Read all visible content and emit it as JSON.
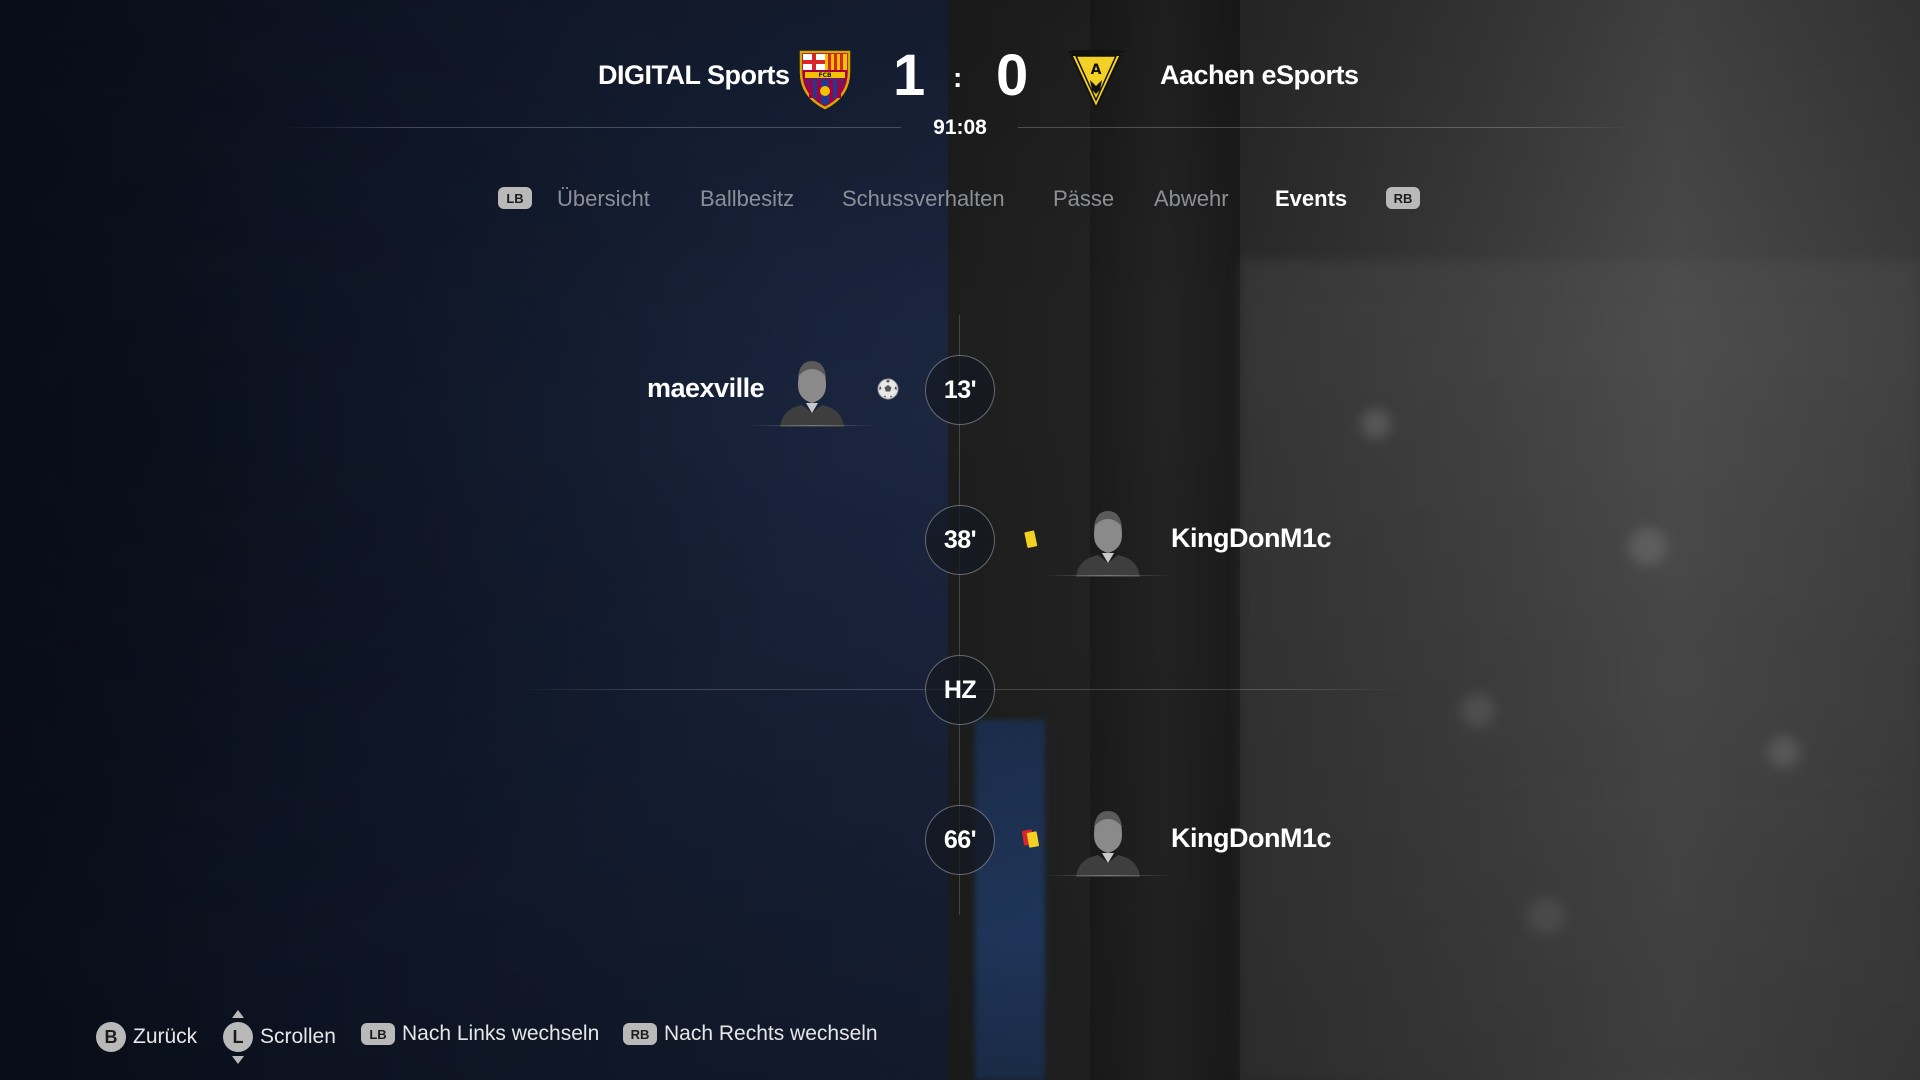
{
  "match": {
    "home_team": "DIGITAL Sports",
    "away_team": "Aachen eSports",
    "home_score": "1",
    "away_score": "0",
    "separator": ":",
    "clock": "91:08",
    "home_crest_icon": "fc-barcelona-crest-icon",
    "away_crest_icon": "alemannia-aachen-crest-icon",
    "home_crest_text": "FCB",
    "away_crest_text": "A"
  },
  "tabs": {
    "prev_hint": "LB",
    "next_hint": "RB",
    "items": [
      {
        "label": "Übersicht",
        "active": false
      },
      {
        "label": "Ballbesitz",
        "active": false
      },
      {
        "label": "Schussverhalten",
        "active": false
      },
      {
        "label": "Pässe",
        "active": false
      },
      {
        "label": "Abwehr",
        "active": false
      },
      {
        "label": "Events",
        "active": true
      }
    ]
  },
  "events": [
    {
      "minute": "13'",
      "side": "home",
      "player": "maexville",
      "type": "goal",
      "icon": "soccer-ball-icon"
    },
    {
      "minute": "38'",
      "side": "away",
      "player": "KingDonM1c",
      "type": "yellow-card",
      "icon": "yellow-card-icon"
    },
    {
      "minute": "HZ",
      "side": "center",
      "player": "",
      "type": "halftime"
    },
    {
      "minute": "66'",
      "side": "away",
      "player": "KingDonM1c",
      "type": "second-yellow-red-card",
      "icon": "yellow-red-card-icon"
    }
  ],
  "footer": {
    "back": {
      "button": "B",
      "label": "Zurück"
    },
    "scroll": {
      "button": "L",
      "label": "Scrollen"
    },
    "left": {
      "button": "LB",
      "label": "Nach Links wechseln"
    },
    "right": {
      "button": "RB",
      "label": "Nach Rechts wechseln"
    }
  },
  "colors": {
    "active_tab": "#ffffff",
    "inactive_tab": "#8c8f96",
    "yellow_card": "#f2d024",
    "red_card": "#d8262b",
    "button_hint": "#b9b9b9"
  }
}
